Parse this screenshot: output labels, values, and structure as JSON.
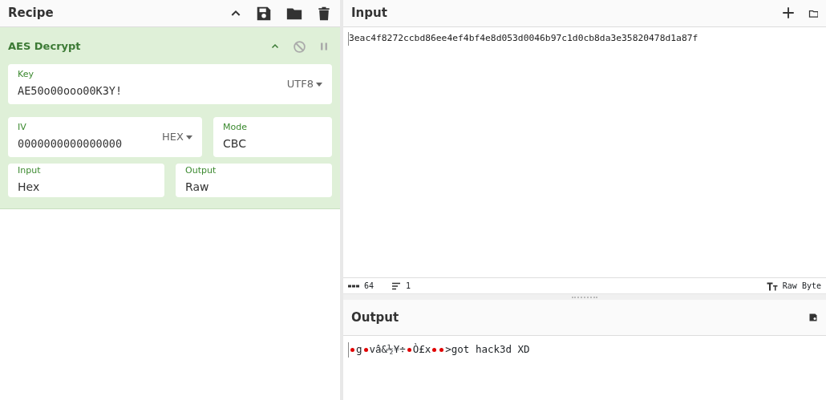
{
  "recipe": {
    "title": "Recipe"
  },
  "operation": {
    "title": "AES Decrypt",
    "disabled": false,
    "paused": false,
    "fields": [
      {
        "label": "Key",
        "value": "AE50o00ooo00K3Y!",
        "dropdown": "UTF8",
        "mono": true
      },
      {
        "label": "IV",
        "value": "0000000000000000",
        "dropdown": "HEX",
        "mono": true
      },
      {
        "label": "Mode",
        "value": "CBC",
        "mono": false
      },
      {
        "label": "Input",
        "value": "Hex",
        "mono": false
      },
      {
        "label": "Output",
        "value": "Raw",
        "mono": false
      }
    ]
  },
  "input": {
    "title": "Input",
    "value": "3eac4f8272ccbd86ee4ef4bf4e8d053d0046b97c1d0cb8da3e35820478d1a87f"
  },
  "status_bar": {
    "length": "64",
    "lines": "1",
    "format": "Raw Byte"
  },
  "output": {
    "title": "Output",
    "segments": [
      {
        "kind": "control"
      },
      {
        "kind": "text",
        "text": "g"
      },
      {
        "kind": "control"
      },
      {
        "kind": "text",
        "text": "vâ&½¥÷"
      },
      {
        "kind": "control"
      },
      {
        "kind": "text",
        "text": "Ò£x"
      },
      {
        "kind": "control"
      },
      {
        "kind": "control"
      },
      {
        "kind": "text",
        "text": ">got hack3d XD"
      }
    ]
  }
}
